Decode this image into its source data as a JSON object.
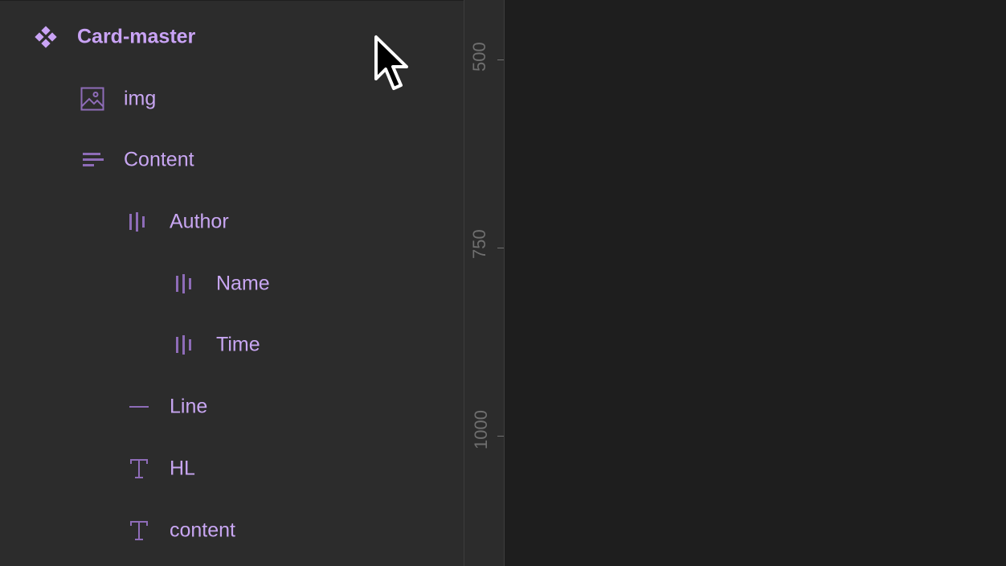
{
  "layers": {
    "items": [
      {
        "label": "Card-master",
        "icon": "component-icon"
      },
      {
        "label": "img",
        "icon": "image-icon"
      },
      {
        "label": "Content",
        "icon": "auto-layout-vertical-icon"
      },
      {
        "label": "Author",
        "icon": "auto-layout-horizontal-icon"
      },
      {
        "label": "Name",
        "icon": "auto-layout-horizontal-icon"
      },
      {
        "label": "Time",
        "icon": "auto-layout-horizontal-icon"
      },
      {
        "label": "Line",
        "icon": "line-icon"
      },
      {
        "label": "HL",
        "icon": "text-icon"
      },
      {
        "label": "content",
        "icon": "text-icon"
      }
    ]
  },
  "ruler": {
    "marks": [
      "500",
      "750",
      "1000"
    ]
  },
  "colors": {
    "panel_bg": "#2c2c2c",
    "canvas_bg": "#1e1e1e",
    "accent_purple": "#c8a6f2",
    "icon_purple": "#8e6cb8"
  }
}
